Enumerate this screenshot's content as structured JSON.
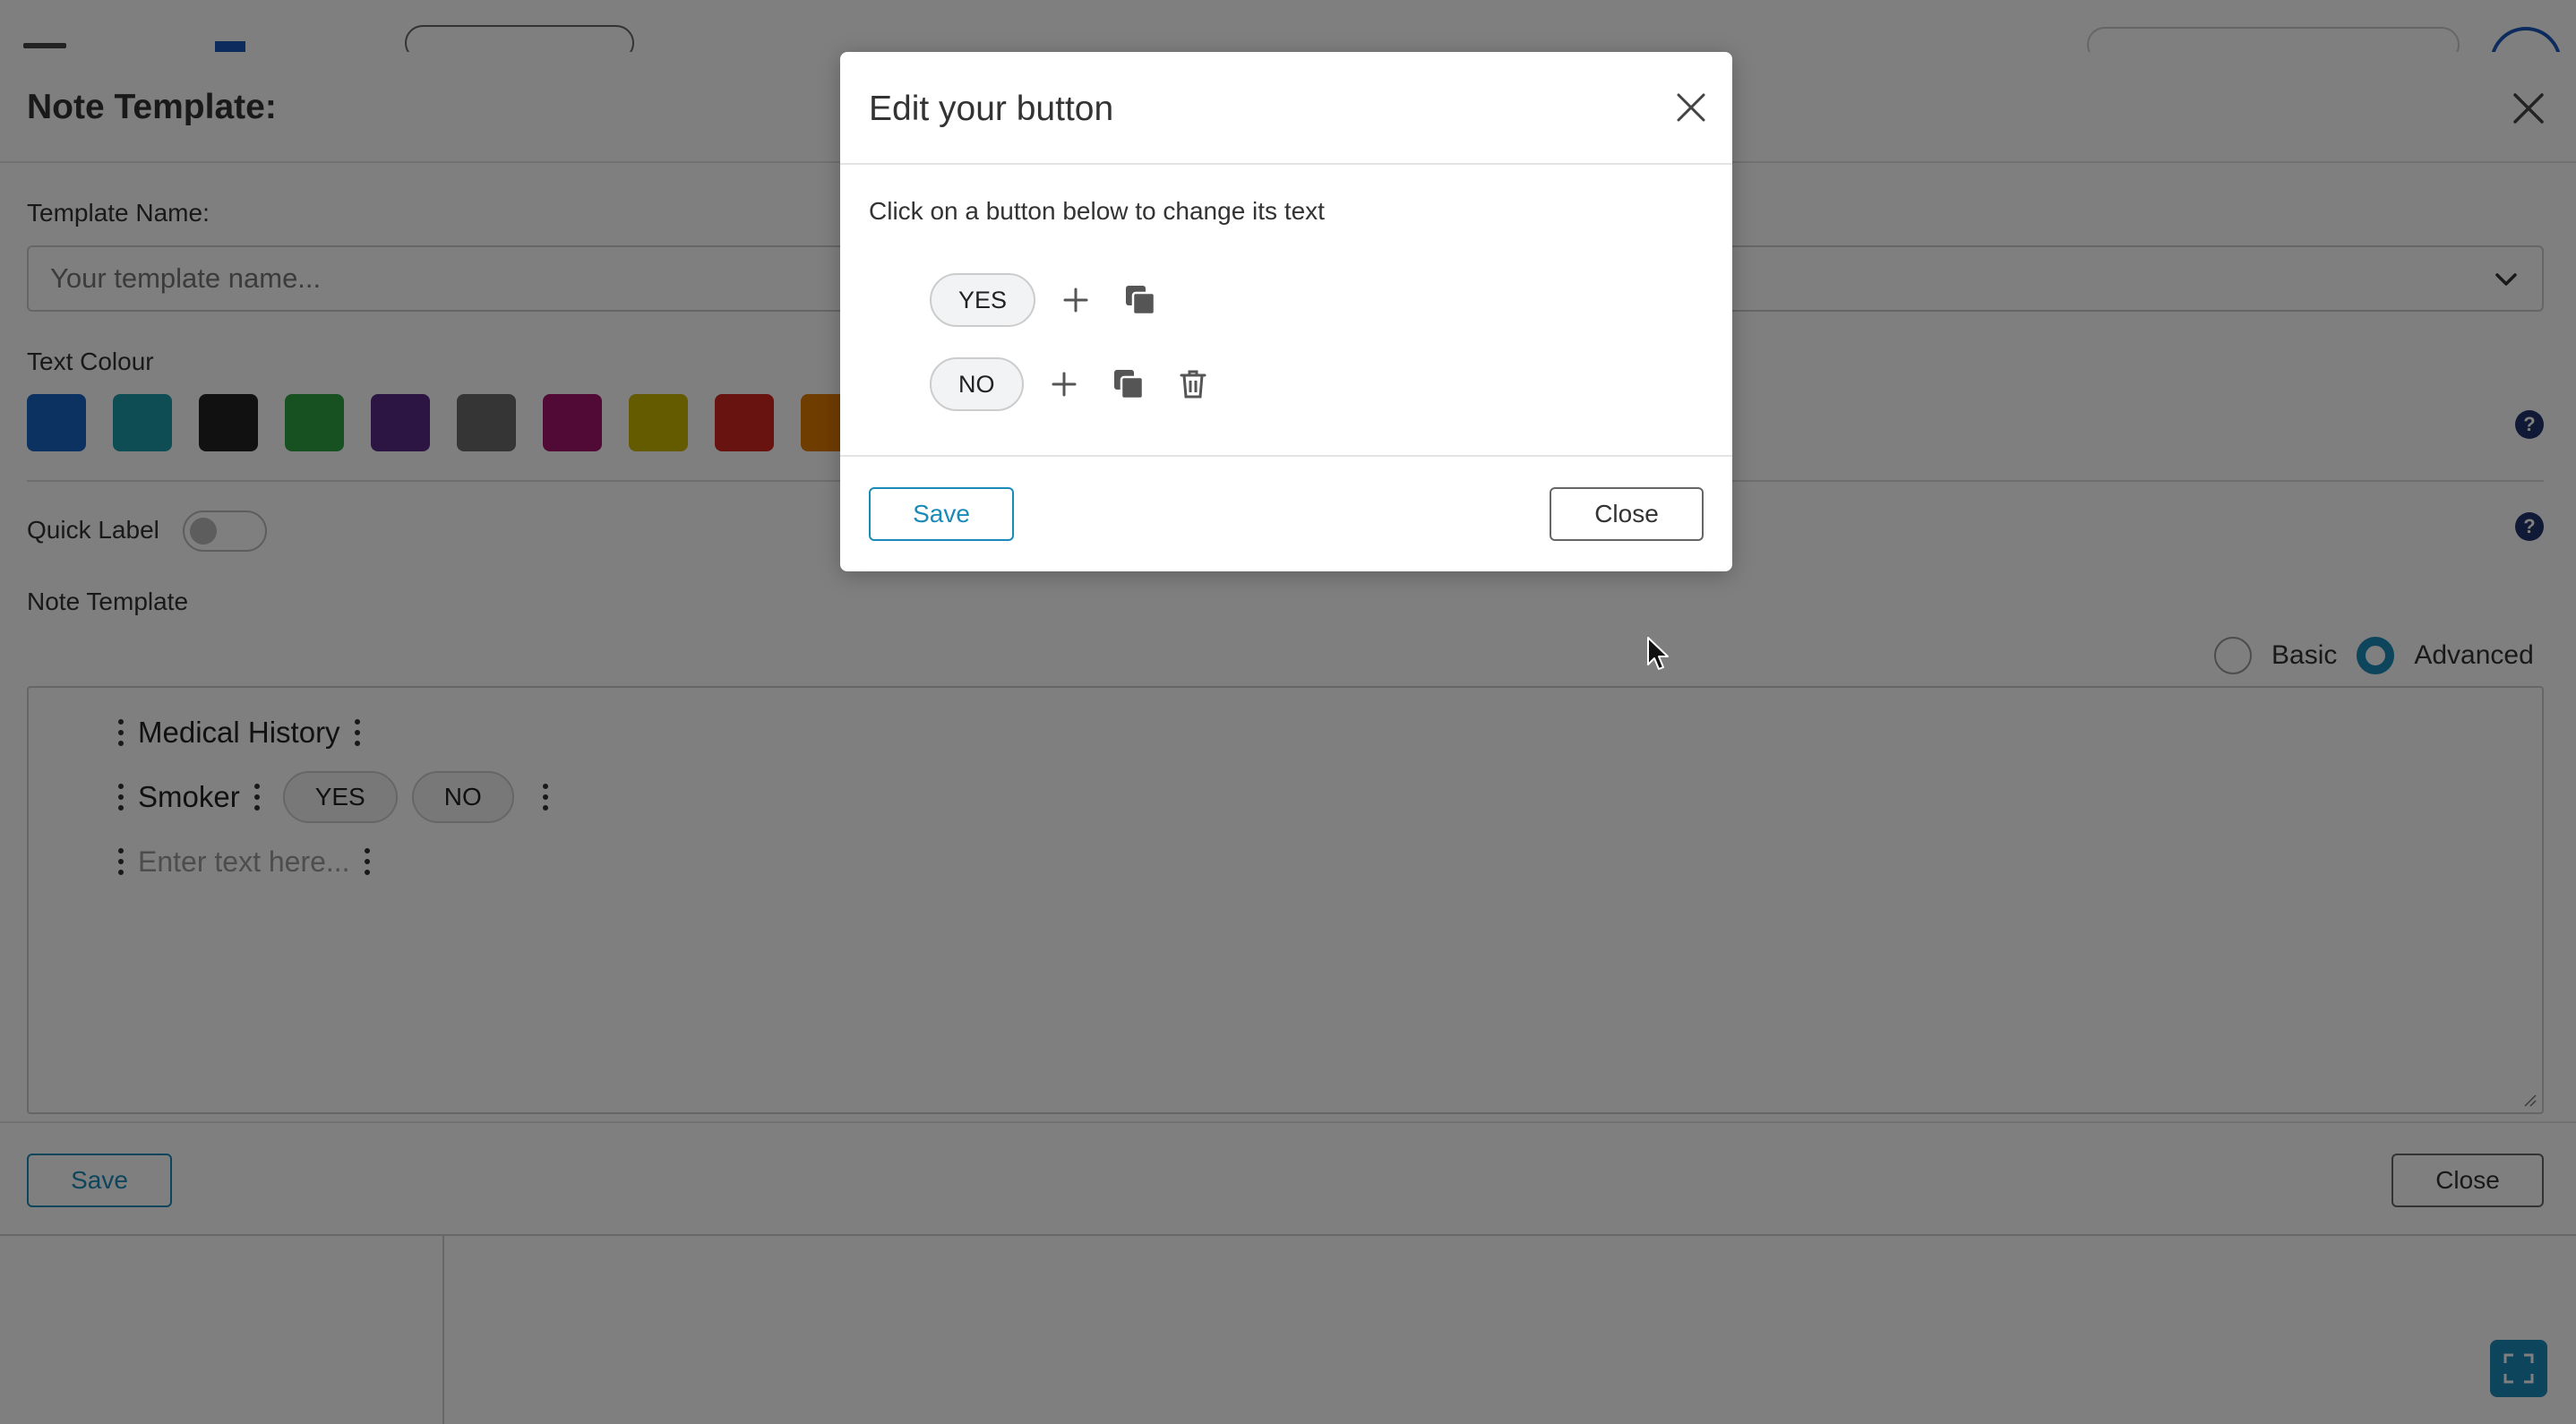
{
  "background": {
    "panel": {
      "title": "Note Template:",
      "template_name_label": "Template Name:",
      "template_name_placeholder": "Your template name...",
      "text_colour_label": "Text Colour",
      "colours": [
        "#1765c0",
        "#1e9aaa",
        "#222222",
        "#2ea043",
        "#5b2a86",
        "#6b6b6b",
        "#a3146b",
        "#c8b400",
        "#d1261f",
        "#e07b00"
      ],
      "quick_label": "Quick Label",
      "note_template_label": "Note Template",
      "mode_basic": "Basic",
      "mode_advanced": "Advanced",
      "mode_selected": "Advanced",
      "help_glyph": "?",
      "editor": {
        "line1": "Medical History",
        "line2": "Smoker",
        "line2_buttons": [
          "YES",
          "NO"
        ],
        "line3_placeholder": "Enter text here..."
      },
      "save_label": "Save",
      "close_label": "Close"
    }
  },
  "modal": {
    "title": "Edit your button",
    "description": "Click on a button below to change its text",
    "buttons": [
      "YES",
      "NO"
    ],
    "save_label": "Save",
    "close_label": "Close"
  },
  "colors": {
    "accent": "#1a8ab8",
    "help_badge": "#20336b",
    "icon_gray": "#555555"
  }
}
